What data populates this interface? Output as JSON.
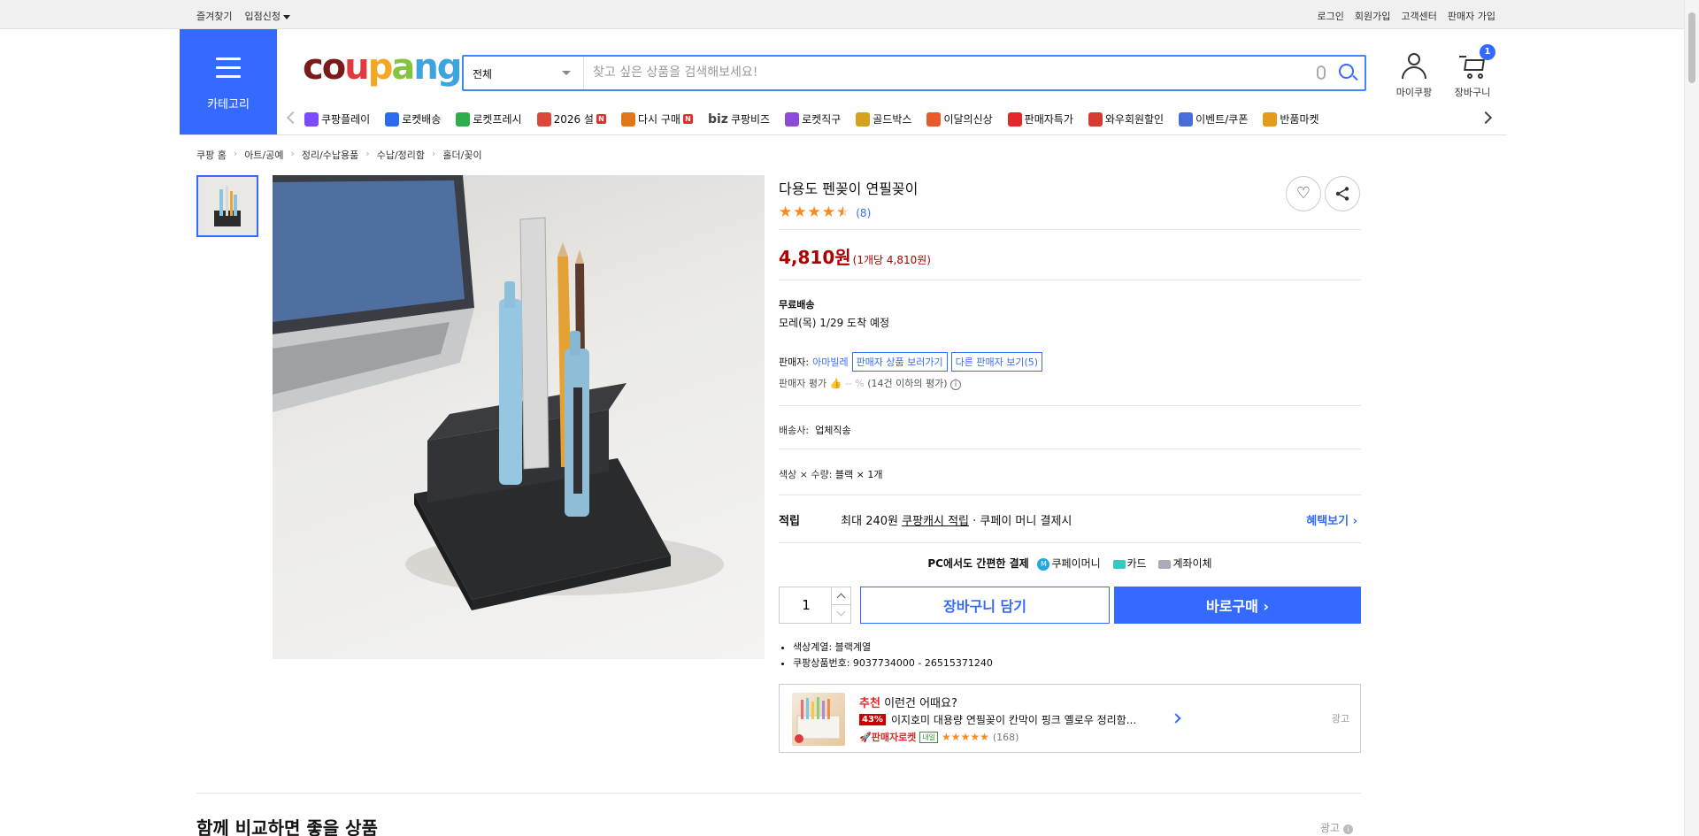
{
  "topbar": {
    "favorites": "즐겨찾기",
    "apply": "입점신청",
    "login": "로그인",
    "signup": "회원가입",
    "support": "고객센터",
    "seller_signup": "판매자 가입"
  },
  "header": {
    "category_label": "카테고리",
    "logo": {
      "c1": "co",
      "c2": "u",
      "c3": "p",
      "c4": "a",
      "c5": "ng"
    },
    "search_scope": "전체",
    "search_placeholder": "찾고 싶은 상품을 검색해보세요!",
    "mycoupang_label": "마이쿠팡",
    "cart_label": "장바구니",
    "cart_count": "1"
  },
  "nav": {
    "items": [
      {
        "label": "쿠팡플레이",
        "color": "#7a4bff"
      },
      {
        "label": "로켓배송",
        "color": "#2a6cf0"
      },
      {
        "label": "로켓프레시",
        "color": "#2cae4a"
      },
      {
        "label": "2026 설",
        "color": "#d9483b"
      },
      {
        "label": "다시 구매",
        "color": "#e0771b"
      },
      {
        "label": "쿠팡비즈",
        "color": "#444444"
      },
      {
        "label": "로켓직구",
        "color": "#8c4bd6"
      },
      {
        "label": "골드박스",
        "color": "#d4a21d"
      },
      {
        "label": "이달의신상",
        "color": "#e85a2a"
      },
      {
        "label": "판매자특가",
        "color": "#e2282b"
      },
      {
        "label": "와우회원할인",
        "color": "#d63b2f"
      },
      {
        "label": "이벤트/쿠폰",
        "color": "#4a6cd8"
      },
      {
        "label": "반품마켓",
        "color": "#e49a1a"
      }
    ],
    "n_badge": "N",
    "biz_prefix": "biz"
  },
  "breadcrumb": [
    "쿠팡 홈",
    "아트/공예",
    "정리/수납용품",
    "수납/정리함",
    "홀더/꽂이"
  ],
  "product": {
    "name": "다용도 펜꽂이 연필꽂이",
    "rating": 4.5,
    "review_count": "(8)",
    "price": "4,810원",
    "unit_price": "(1개당 4,810원)",
    "shipping_title": "무료배송",
    "arrival": "모레(목) 1/29 도착 예정",
    "seller_label": "판매자:",
    "seller_name": "아마빌레",
    "seller_products_btn": "판매자 상품 보러가기",
    "other_sellers_btn": "다른 판매자 보기(5)",
    "seller_rating_label": "판매자 평가",
    "seller_rating_value": "-- %",
    "seller_rating_note": "(14건 이하의 평가)",
    "carrier_label": "배송사:",
    "carrier_value": "업체직송",
    "option_label": "색상 × 수량:",
    "option_value": "블랙 × 1개",
    "earn_label": "적립",
    "earn_text1": "최대 240원",
    "earn_link": "쿠팡캐시 적립",
    "earn_text2": "· 쿠페이 머니 결제시",
    "earn_more": "혜택보기",
    "pay_title": "PC에서도 간편한 결제",
    "pay_money": "쿠페이머니",
    "pay_card": "카드",
    "pay_account": "계좌이체",
    "quantity": "1",
    "cart_btn": "장바구니 담기",
    "buy_btn": "바로구매",
    "attributes": [
      "색상계열: 블랙계열",
      "쿠팡상품번호: 9037734000 - 26515371240"
    ]
  },
  "recommend": {
    "prefix": "추천",
    "title": "이런건 어때요?",
    "discount": "43%",
    "item_name": "이지호미 대용량 연필꽂이 칸막이 핑크 옐로우 정리함...",
    "rocket_label": "판매자로켓",
    "tomorrow": "내일",
    "stars": "★★★★★",
    "count": "(168)",
    "ad_label": "광고"
  },
  "compare": {
    "title": "함께 비교하면 좋을 상품",
    "ad_label": "광고"
  }
}
